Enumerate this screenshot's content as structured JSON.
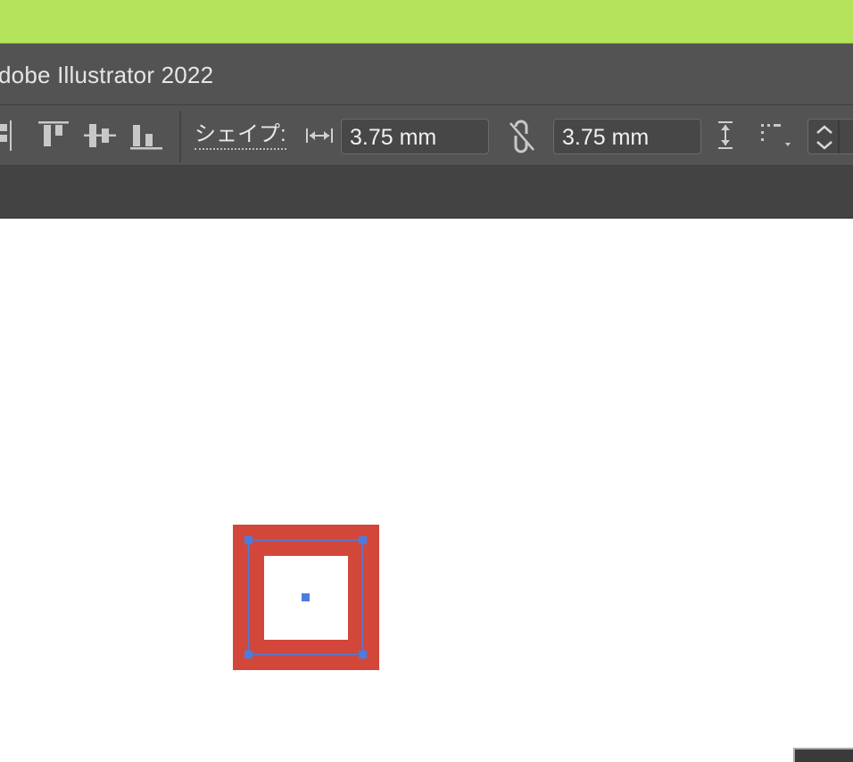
{
  "window": {
    "title": "dobe Illustrator 2022"
  },
  "control_bar": {
    "shape_label": "シェイプ:",
    "width_value": "3.75 mm",
    "height_value": "3.75 mm",
    "icons": [
      "distribute-icon",
      "align-top-icon",
      "align-vertical-center-icon",
      "align-bottom-icon",
      "width-icon",
      "unlink-proportions-icon",
      "height-icon",
      "transform-reference-icon",
      "stepper-icon"
    ]
  },
  "artwork": {
    "shape": "square-with-stroke",
    "stroke_color": "#d2473a",
    "fill_color": "#ffffff",
    "selection_color": "#4a7de0"
  },
  "colors": {
    "accent_bar": "#b4e35c",
    "ui_dark": "#535353"
  }
}
